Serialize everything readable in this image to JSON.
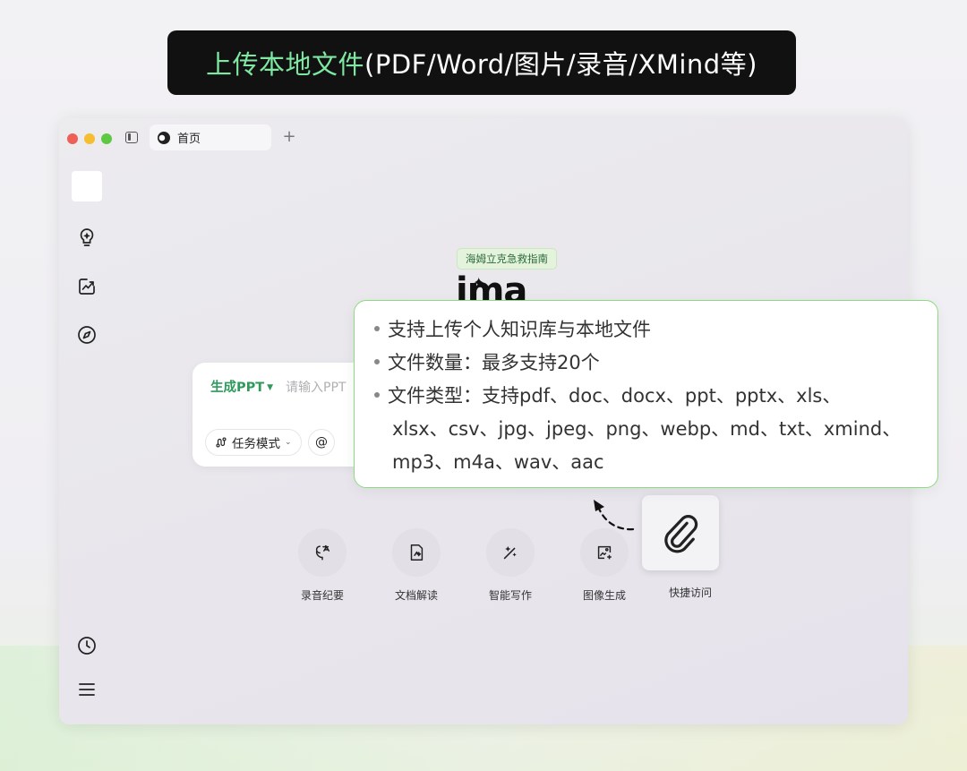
{
  "banner": {
    "highlight": "上传本地文件",
    "rest": " (PDF/Word/图片/录音/XMind等)"
  },
  "window": {
    "traffic_colors": [
      "#ee5f57",
      "#f5bd2f",
      "#5dc842"
    ],
    "tab_label": "首页",
    "new_tab": "+",
    "sidebar_icons": [
      "lightbulb-icon",
      "edit-chart-icon",
      "compass-icon",
      "clock-icon",
      "menu-icon"
    ],
    "chip": "海姆立克急救指南",
    "logo": "ima",
    "input": {
      "mode_label": "生成PPT",
      "placeholder": "请输入PPT",
      "task_mode": "任务模式",
      "at": "@"
    },
    "tools": [
      {
        "label": "录音纪要",
        "icon": "mic-icon"
      },
      {
        "label": "文档解读",
        "icon": "doc-icon"
      },
      {
        "label": "智能写作",
        "icon": "wand-icon"
      },
      {
        "label": "图像生成",
        "icon": "image-icon"
      }
    ],
    "quick_access": {
      "label": "快捷访问",
      "icon": "paperclip-icon"
    }
  },
  "tooltip": {
    "lines": [
      "支持上传个人知识库与本地文件",
      "文件数量：最多支持20个",
      "文件类型：支持pdf、doc、docx、ppt、pptx、xls、"
    ],
    "continuation": [
      "xlsx、csv、jpg、jpeg、png、webp、md、txt、xmind、",
      "mp3、m4a、wav、aac"
    ],
    "border_color": "#8bdc7e"
  }
}
